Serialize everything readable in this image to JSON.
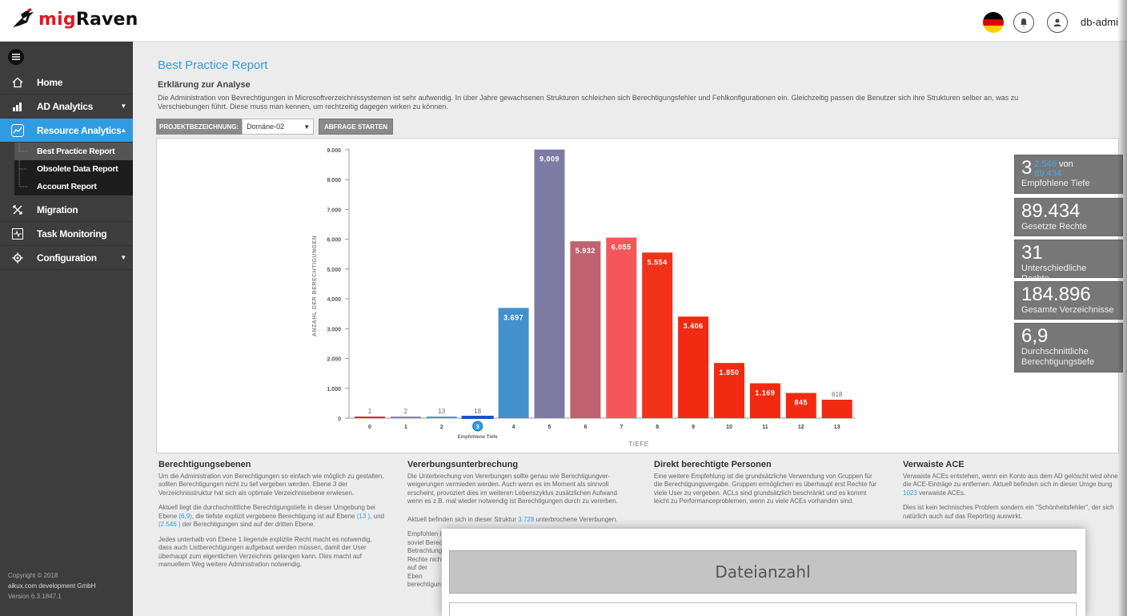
{
  "app": {
    "brand_mig": "mig",
    "brand_raven": "Raven"
  },
  "header": {
    "user": "db-admi"
  },
  "sidebar": {
    "items": [
      {
        "label": "Home",
        "icon": "home-icon"
      },
      {
        "label": "AD Analytics",
        "icon": "bar-chart-icon"
      },
      {
        "label": "Resource Analytics",
        "icon": "line-chart-icon"
      },
      {
        "label": "Migration",
        "icon": "migration-icon"
      },
      {
        "label": "Task Monitoring",
        "icon": "monitor-icon"
      },
      {
        "label": "Configuration",
        "icon": "config-icon"
      }
    ],
    "subitems": [
      {
        "label": "Best Practice Report"
      },
      {
        "label": "Obsolete Data Report"
      },
      {
        "label": "Account Report"
      }
    ],
    "footer": {
      "copyright": "Copyright © 2018",
      "company": "aikux.com development GmbH",
      "version": "Version 6.3.1847.1"
    }
  },
  "main": {
    "title": "Best Practice Report",
    "section_title": "Erklärung zur Analyse",
    "intro_line1": "Die Administration von Bevrechtigungen in Microsoftverzeichnissystemen ist sehr aufwendig. In über Jahre gewachsenen Strukturen schleichen sich Berechtigungsfehler und Fehlkonfigurationen ein. Gleichzeitig passen die Benutzer sich ihre Strukturen selber an, was zu",
    "intro_line2": "Verschiebungen führt. Diese muss man kennen, um rechtzeitig dagegen wirken zu können.",
    "toolbar": {
      "label": "PROJEKTBEZEICHNUNG:",
      "select_value": "Domäne-02",
      "button": "ABFRAGE STARTEN"
    }
  },
  "stats": [
    {
      "value_main": "3",
      "value_small1": "2.546",
      "value_mid": "von",
      "value_small2": "89.434",
      "label": "Empfohlene Tiefe"
    },
    {
      "value_main": "89.434",
      "label": "Gesetzte Rechte"
    },
    {
      "value_main": "31",
      "label": "Unterschiedliche Rechte"
    },
    {
      "value_main": "184.896",
      "label": "Gesamte Verzeichnisse"
    },
    {
      "value_main": "6,9",
      "label": "Durchschnittliche Berechtigungstiefe"
    }
  ],
  "chart_data": {
    "type": "bar",
    "xlabel": "TIEFE",
    "ylabel": "ANZAHL DER BERECHTIGUNGEN",
    "ylim": [
      0,
      9000
    ],
    "yticks": [
      "0",
      "1.000",
      "2.000",
      "3.000",
      "4.000",
      "5.000",
      "6.000",
      "7.000",
      "8.000",
      "9.000"
    ],
    "categories": [
      "0",
      "1",
      "2",
      "3",
      "4",
      "5",
      "6",
      "7",
      "8",
      "9",
      "10",
      "11",
      "12",
      "13"
    ],
    "values": [
      1,
      2,
      13,
      18,
      3697,
      9009,
      5932,
      6055,
      5554,
      3406,
      1850,
      1169,
      845,
      618
    ],
    "labels": [
      "1",
      "2",
      "13",
      "18",
      "3.697",
      "9.009",
      "5.932",
      "6.055",
      "5.554",
      "3.406",
      "1.850",
      "1.169",
      "845",
      "618"
    ],
    "colors": [
      "#ee2a1b",
      "#8a86b0",
      "#4a9bd6",
      "#4a9bd6",
      "#4490cc",
      "#7e7ba3",
      "#c0626f",
      "#f4565a",
      "#f33119",
      "#f22a12",
      "#f22a12",
      "#f22a12",
      "#f22a12",
      "#f22a12"
    ],
    "recommended_label": "Empfohlene Tiefe",
    "recommended_index": 3
  },
  "info": [
    {
      "title": "Berechtigungsebenen",
      "p1": "Um die Administration von Berechtigungen so einfach wie möglich zu gestalten, sollten Berechtigungen nicht zu tief vergeben werden. Ebene 3 der Verzeichnisstruktur hat sich als optimale Verzeichnisebene erwiesen.",
      "p2a": "Aktuell liegt die durchschnittliche Berechtigungstiefe in dieser Umgebung bei Ebene ",
      "p2l1": "(6,9)",
      "p2b": ", die tiefste explizit vergebene Berechtigung ist auf Ebene ",
      "p2l2": "(13 )",
      "p2c": ", und ",
      "p2l3": "(2.546 )",
      "p2d": " der Berechtigungen sind auf der dritten Ebene.",
      "p3": "Jedes unterhalb von Ebene 1 liegende explizite Recht macht es notwendig, dass auch Listberechtigungen aufgebaut werden müssen, damit der User überhaupt zum eigentlichen Verzeichnis gelangen kann. Dies macht auf manuellem Weg weitere Administration notwendig."
    },
    {
      "title": "Vererbungsunterbrechung",
      "p1": "Die Unterbrechung von Vererbungen sollte genau wie Berechtigungver-weigerungen vermieden werden. Auch wenn es im Moment als sinnvoll erscheint, provoziert dies im weiteren Lebenszyklus zusätzlichen Aufwand wenn es z.B. mal wieder notwendig ist Berechtigungen durch zu vererben.",
      "p2a": "Aktuell befinden sich in dieser Struktur ",
      "p2l1": "3.728",
      "p2b": " unterbrochene Vererbungen.",
      "p3": "Empfohlen i soviel Berec Betrachtung Rechte nicht auf der Eben berechtigun"
    },
    {
      "title": "Direkt berechtigte Personen",
      "p1": "Eine weitere Empfehlung ist die grundsätzliche Verwendung von Gruppen für die Berechtigungsvergabe. Gruppen ermöglichen es überhaupt erst Rechte für viele User zu vergeben. ACLs sind grundsätzlich beschränkt und es kommt leicht zu Performanceproblemen, wenn zu viele ACEs vorhanden sind."
    },
    {
      "title": "Verwaiste ACE",
      "p1a": "Verwaiste ACEs entstehen, wenn ein Konto aus dem AD gelöscht wird ohne die ACE-Einträge zu entfernen. Aktuell befinden sich in dieser Umge bung ",
      "p1l": "1023",
      "p1b": " verwaiste ACEs.",
      "p2": "Dies ist kein technisches Problem sondern ein \"Schönheitsfehler\", der sich natürlich auch auf das Reporting auswirkt."
    }
  ],
  "modal": {
    "button": "Dateianzahl"
  },
  "colors": {
    "accent": "#2f9ce0",
    "sidebar": "#3d3d3d",
    "stat_box": "#777777"
  }
}
